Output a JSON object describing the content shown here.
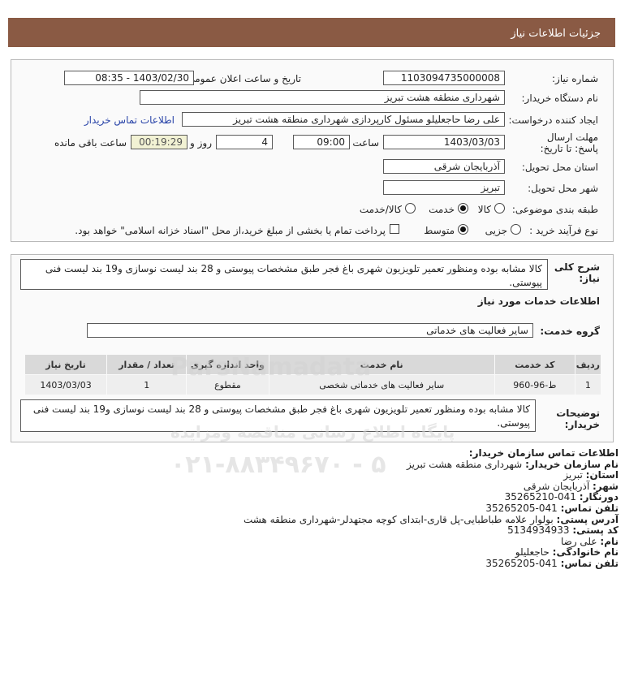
{
  "header": {
    "title": "جزئیات اطلاعات نیاز"
  },
  "form": {
    "need_number_label": "شماره نیاز:",
    "need_number": "1103094735000008",
    "announce_label": "تاریخ و ساعت اعلان عمومی:",
    "announce_value": "1403/02/30 - 08:35",
    "buyer_org_label": "نام دستگاه خریدار:",
    "buyer_org": "شهرداری منطقه هشت تبریز",
    "creator_label": "ایجاد کننده درخواست:",
    "creator": "علی رضا حاجعلیلو مسئول کارپردازی شهرداری منطقه هشت تبریز",
    "contact_link": "اطلاعات تماس خریدار",
    "deadline_label": "مهلت ارسال پاسخ: تا تاریخ:",
    "deadline_date": "1403/03/03",
    "time_label": "ساعت",
    "deadline_time": "09:00",
    "days": "4",
    "days_label": "روز و",
    "remaining_time": "00:19:29",
    "remaining_label": "ساعت باقی مانده",
    "province_label": "استان محل تحویل:",
    "province": "آذربایجان شرقی",
    "city_label": "شهر محل تحویل:",
    "city": "تبریز",
    "category_label": "طبقه بندی موضوعی:",
    "category_options": [
      "کالا",
      "خدمت",
      "کالا/خدمت"
    ],
    "category_selected": "خدمت",
    "process_label": "نوع فرآیند خرید :",
    "process_options": [
      "جزیی",
      "متوسط"
    ],
    "process_selected": "متوسط",
    "payment_note": "پرداخت تمام یا بخشی از مبلغ خرید،از محل \"اسناد خزانه اسلامی\" خواهد بود."
  },
  "details": {
    "summary_label": "شرح کلی نیاز:",
    "summary": "کالا مشابه بوده ومنظور تعمیر تلویزیون شهری باغ فجر طبق مشخصات پیوستی و 28 بند لیست نوسازی و19 بند لیست فنی پیوستی.",
    "services_heading": "اطلاعات خدمات مورد نیاز",
    "service_group_label": "گروه خدمت:",
    "service_group": "سایر فعالیت های خدماتی",
    "table_headers": [
      "ردیف",
      "کد خدمت",
      "نام خدمت",
      "واحد اندازه گیری",
      "تعداد / مقدار",
      "تاریخ نیاز"
    ],
    "table_rows": [
      [
        "1",
        "ط-96-960",
        "سایر فعالیت های خدماتی شخصی",
        "مقطوع",
        "1",
        "1403/03/03"
      ]
    ],
    "buyer_notes_label": "توضیحات خریدار:",
    "buyer_notes": "کالا مشابه بوده ومنظور تعمیر تلویزیون شهری باغ فجر طبق مشخصات پیوستی و 28 بند لیست نوسازی و19 بند لیست فنی پیوستی."
  },
  "contact": {
    "heading": "اطلاعات تماس سازمان خریدار:",
    "org_label": "نام سازمان خریدار:",
    "org": "شهرداری منطقه هشت تبریز",
    "province_label": "استان:",
    "province": "تبریز",
    "city_label": "شهر:",
    "city": "آذربایجان شرقی",
    "fax_label": "دورنگار:",
    "fax": "041-35265210",
    "phone_label": "تلفن تماس:",
    "phone": "041-35265205",
    "address_label": "آدرس پستی:",
    "address": "بولوار علامه طباطبایی-پل قاری-ابتدای کوچه مجتهدلر-شهرداری منطقه هشت",
    "postal_label": "کد پستی:",
    "postal": "5134934933",
    "name_label": "نام:",
    "name": "علی رضا",
    "family_label": "نام خانوادگی:",
    "family": "حاجعلیلو",
    "phone2_label": "تلفن تماس:",
    "phone2": "041-35265205"
  },
  "watermark": {
    "brand": "ParsNamadata",
    "line": "پایگاه اطلاع رسانی مناقصه ومزایده",
    "phone": "۰۲۱-۸۸۳۴۹۶۷۰ - ۵"
  }
}
